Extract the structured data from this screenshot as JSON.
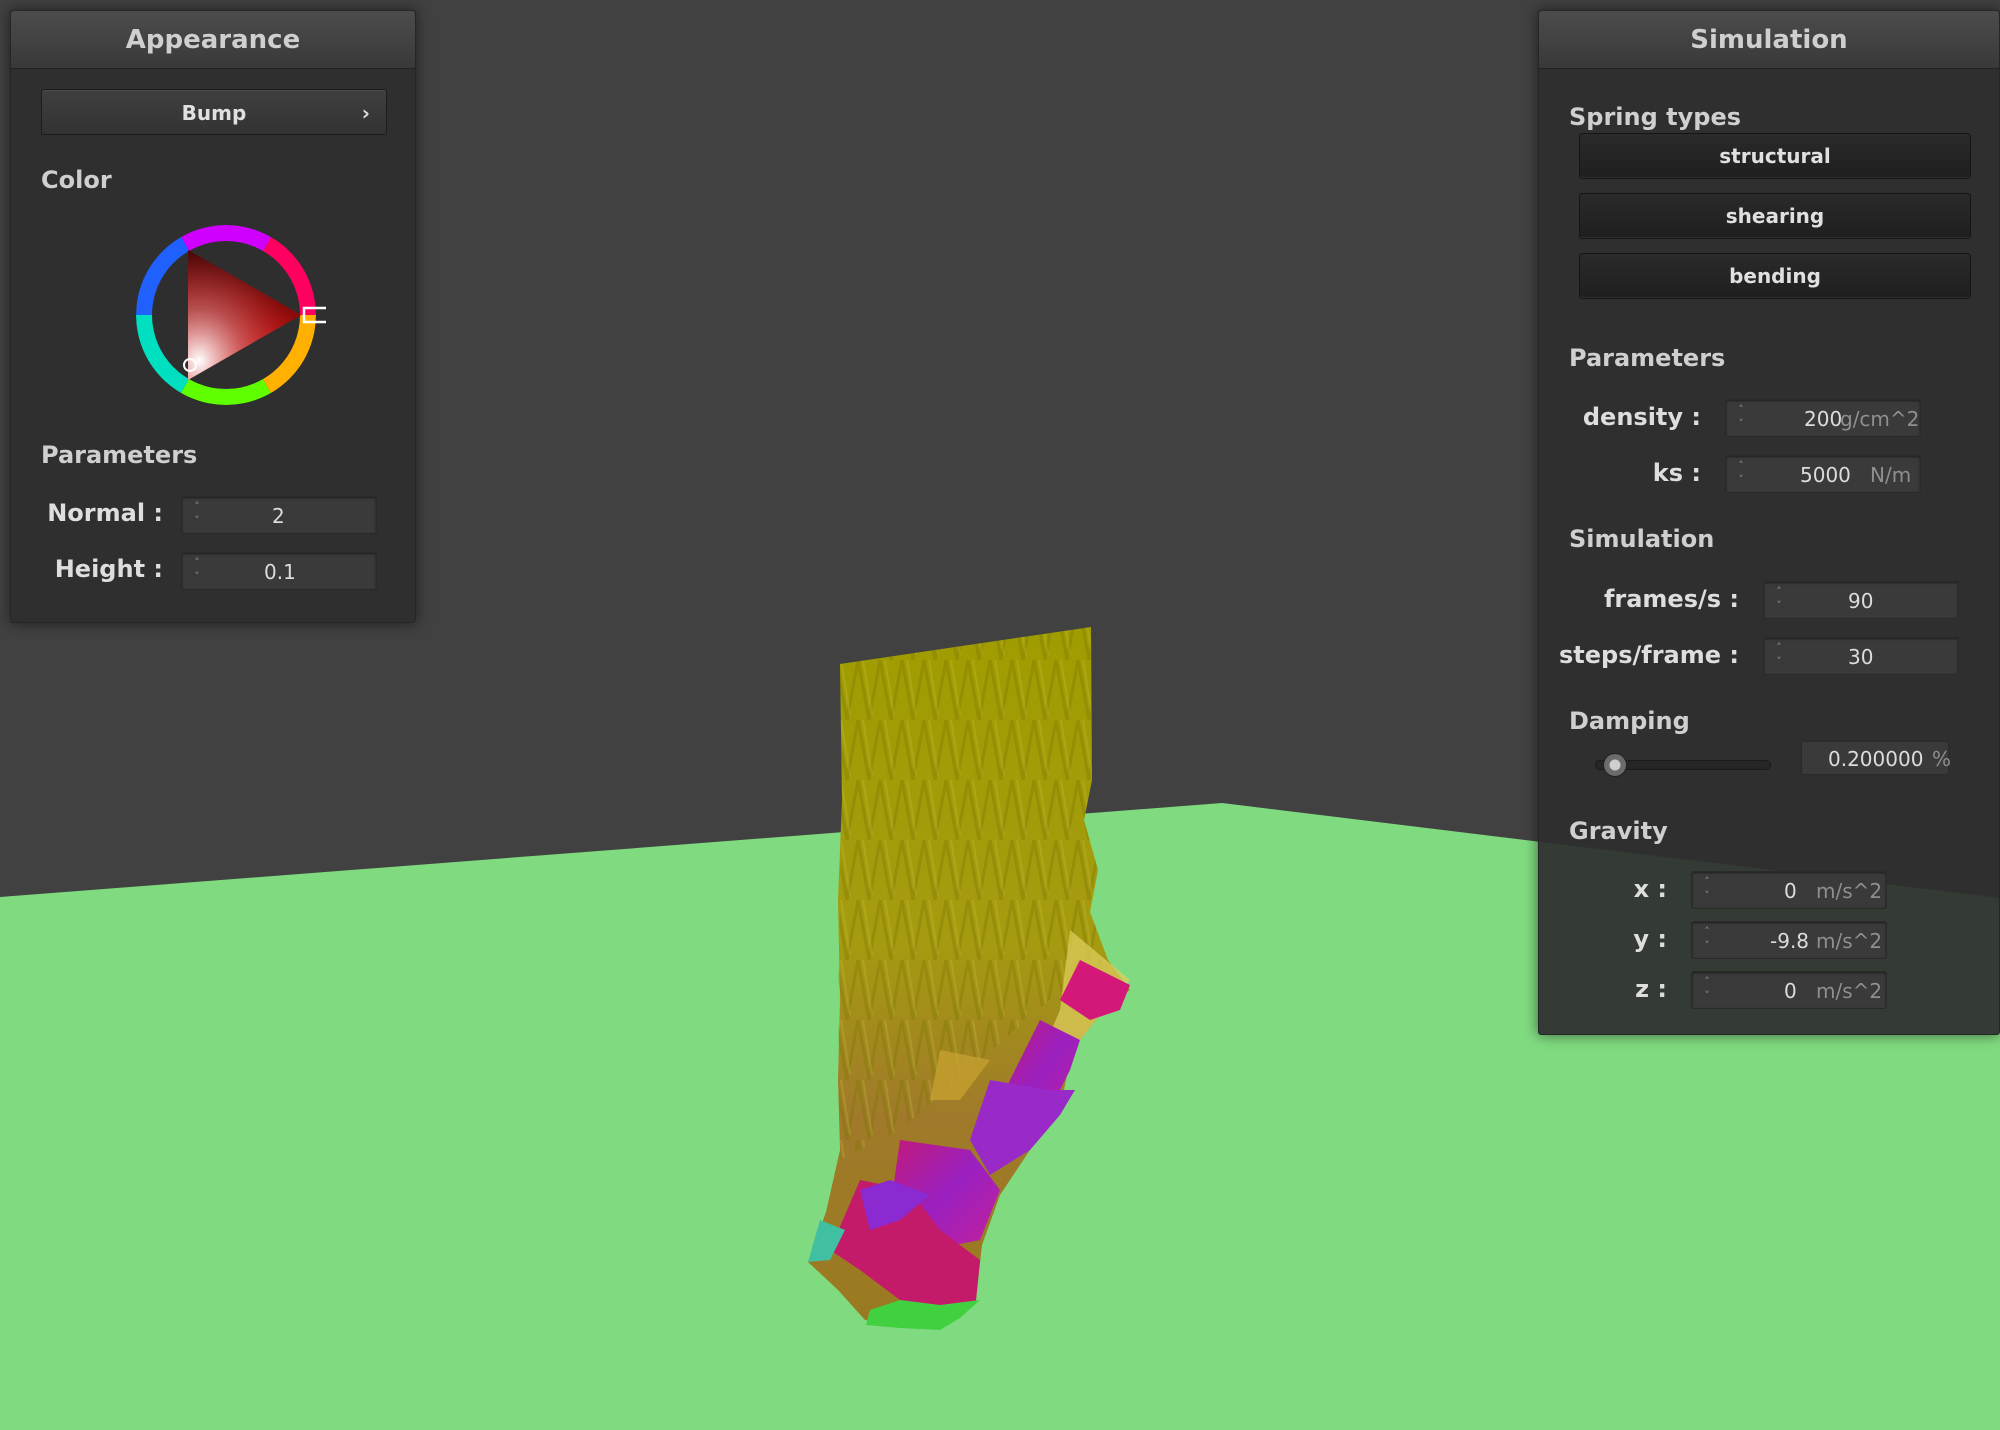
{
  "colors": {
    "ground": "#80db80",
    "sky": "#414141",
    "panel": "#2e2e2e"
  },
  "appearance": {
    "title": "Appearance",
    "shader_button": "Bump",
    "shader_chevron": "›",
    "color_label": "Color",
    "params_label": "Parameters",
    "normal_label": "Normal :",
    "normal_value": "2",
    "height_label": "Height :",
    "height_value": "0.1"
  },
  "simulation": {
    "title": "Simulation",
    "spring_label": "Spring types",
    "springs": [
      "structural",
      "shearing",
      "bending"
    ],
    "params_label": "Parameters",
    "density_label": "density :",
    "density_value": "200",
    "density_unit": "g/cm^2",
    "ks_label": "ks :",
    "ks_value": "5000",
    "ks_unit": "N/m",
    "sim_label": "Simulation",
    "fps_label": "frames/s :",
    "fps_value": "90",
    "spf_label": "steps/frame :",
    "spf_value": "30",
    "damping_label": "Damping",
    "damping_value": "0.200000",
    "damping_unit": "%",
    "gravity_label": "Gravity",
    "gx_label": "x :",
    "gx_value": "0",
    "gy_label": "y :",
    "gy_value": "-9.8",
    "gz_label": "z :",
    "gz_value": "0",
    "g_unit": "m/s^2"
  }
}
